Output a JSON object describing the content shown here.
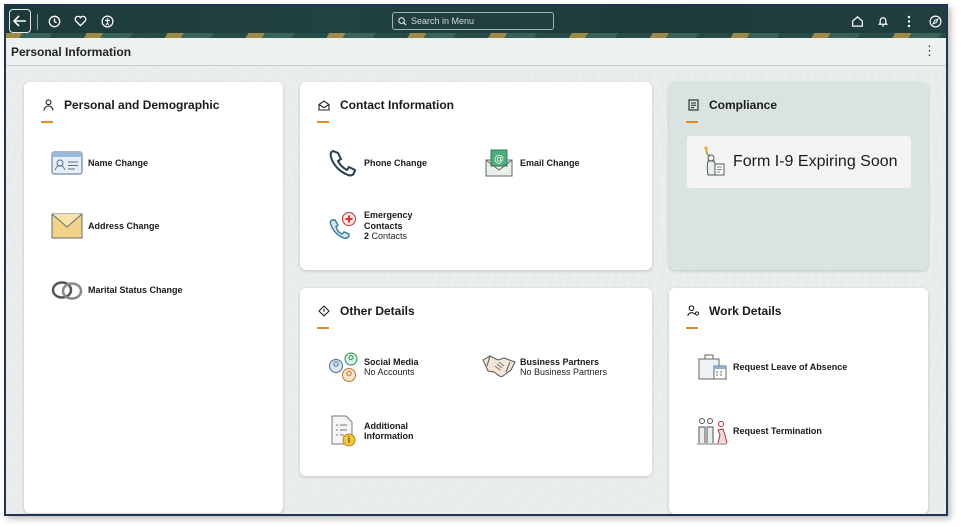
{
  "topbar": {
    "search_placeholder": "Search in Menu",
    "icons": [
      "back-arrow-icon",
      "history-icon",
      "heart-icon",
      "accessibility-icon",
      "home-icon",
      "bell-icon",
      "more-vertical-icon",
      "compass-icon"
    ]
  },
  "page": {
    "title": "Personal Information"
  },
  "tiles": {
    "personal": {
      "title": "Personal and Demographic",
      "items": [
        {
          "label": "Name Change"
        },
        {
          "label": "Address Change"
        },
        {
          "label": "Marital Status Change"
        }
      ]
    },
    "contact": {
      "title": "Contact Information",
      "items": [
        {
          "label": "Phone Change"
        },
        {
          "label": "Email Change"
        },
        {
          "label_line1": "Emergency",
          "label_line2": "Contacts",
          "count": "2",
          "count_suffix": " Contacts"
        }
      ]
    },
    "compliance": {
      "title": "Compliance",
      "form": {
        "label": "Form I-9",
        "status": "Expiring Soon"
      }
    },
    "other": {
      "title": "Other Details",
      "items": [
        {
          "label": "Social Media",
          "sub": "No Accounts"
        },
        {
          "label": "Business Partners",
          "sub": "No Business Partners"
        },
        {
          "label_line1": "Additional",
          "label_line2": "Information"
        }
      ]
    },
    "work": {
      "title": "Work Details",
      "items": [
        {
          "label": "Request Leave of Absence"
        },
        {
          "label": "Request Termination"
        }
      ]
    }
  },
  "colors": {
    "accent": "#e58b2a",
    "topbar": "#1d3a3a",
    "compliance_bg": "#d8e3e2",
    "frame_border": "#1f3550"
  }
}
